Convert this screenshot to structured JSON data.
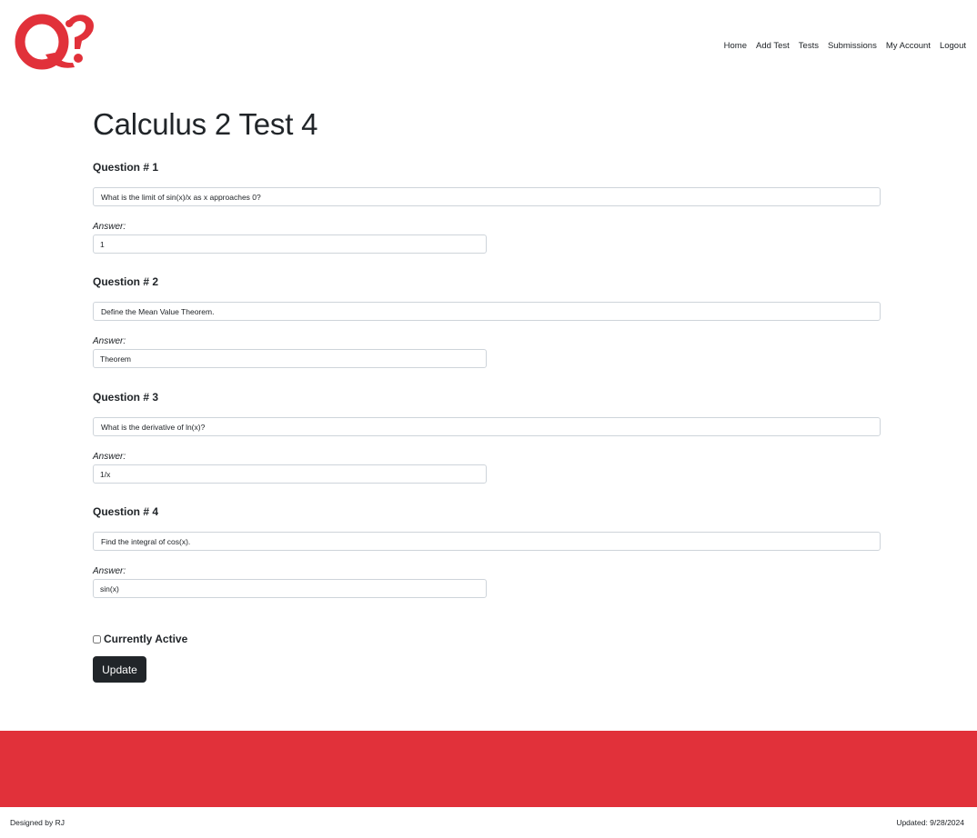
{
  "nav": {
    "items": [
      "Home",
      "Add Test",
      "Tests",
      "Submissions",
      "My Account",
      "Logout"
    ]
  },
  "page": {
    "title": "Calculus 2 Test 4"
  },
  "questions": [
    {
      "heading": "Question # 1",
      "text": "What is the limit of sin(x)/x as x approaches 0?",
      "answer_label": "Answer:",
      "answer": "1"
    },
    {
      "heading": "Question # 2",
      "text": "Define the Mean Value Theorem.",
      "answer_label": "Answer:",
      "answer": "Theorem"
    },
    {
      "heading": "Question # 3",
      "text": "What is the derivative of ln(x)?",
      "answer_label": "Answer:",
      "answer": "1/x"
    },
    {
      "heading": "Question # 4",
      "text": "Find the integral of cos(x).",
      "answer_label": "Answer:",
      "answer": "sin(x)"
    }
  ],
  "form": {
    "active_label": "Currently Active",
    "active_checked": false,
    "update_label": "Update"
  },
  "footer": {
    "designed_by": "Designed by RJ",
    "updated": "Updated: 9/28/2024"
  },
  "colors": {
    "brand_red": "#e1313a",
    "button_dark": "#212529"
  },
  "icons": {
    "logo": "q-question-logo"
  }
}
